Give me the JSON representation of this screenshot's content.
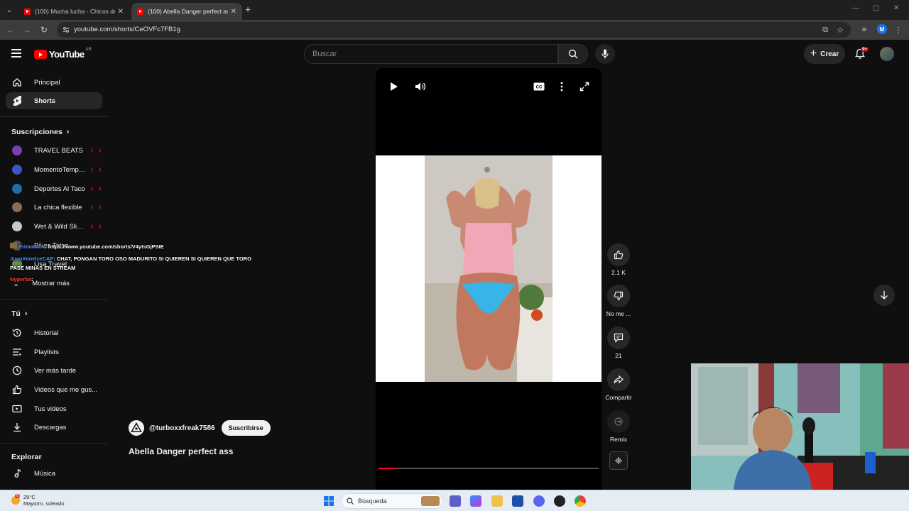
{
  "browser": {
    "tabs": [
      {
        "title": "(100) Mucha lucha - Chicos de",
        "active": false
      },
      {
        "title": "(100) Abella Danger perfect ass",
        "active": true
      }
    ],
    "url": "youtube.com/shorts/CeOVFc7FB1g",
    "profile_initial": "M"
  },
  "yt_header": {
    "logo_text": "YouTube",
    "country": "AR",
    "search_placeholder": "Buscar",
    "create_label": "Crear",
    "notification_badge": "9+"
  },
  "sidebar": {
    "main": [
      {
        "label": "Principal",
        "icon": "home-icon"
      },
      {
        "label": "Shorts",
        "icon": "shorts-icon",
        "active": true
      }
    ],
    "subs_header": "Suscripciones",
    "subscriptions": [
      {
        "name": "TRAVEL BEATS",
        "color": "#7a3fb0"
      },
      {
        "name": "MomentoTempu...",
        "color": "#3a55c7"
      },
      {
        "name": "Deportes Al Taco",
        "color": "#1f6fa8"
      },
      {
        "name": "La chica flexible",
        "color": "#8a6a5a"
      },
      {
        "name": "Wet & Wild Slides",
        "color": "#c8c8c8"
      },
      {
        "name": "Bikes Tatoo",
        "color": "#555555"
      },
      {
        "name": "Lisa Travel",
        "color": "#6a8a4a"
      }
    ],
    "show_more": "Mostrar más",
    "you_header": "Tú",
    "you_items": [
      {
        "label": "Historial",
        "icon": "history-icon"
      },
      {
        "label": "Playlists",
        "icon": "playlist-icon"
      },
      {
        "label": "Ver más tarde",
        "icon": "clock-icon"
      },
      {
        "label": "Videos que me gus...",
        "icon": "thumbs-up-icon"
      },
      {
        "label": "Tus videos",
        "icon": "video-icon"
      },
      {
        "label": "Descargas",
        "icon": "download-icon"
      }
    ],
    "explore_header": "Explorar",
    "explore_items": [
      {
        "label": "Música",
        "icon": "music-icon"
      }
    ]
  },
  "chat_overlay": [
    {
      "user": "PrimaIsOk",
      "text": ": https://www.youtube.com/shorts/V4ytsGjPSIE"
    },
    {
      "user": "JuanXenelzeCAP",
      "text": ": CHAT, PONGAN TORO OSO MADURITO SI QUIEREN SI QUIEREN QUE TORO PASE MINAS EN STREAM"
    },
    {
      "user": "Nyperba",
      "text": ": "
    }
  ],
  "short": {
    "channel": "@turboxxfreak7586",
    "subscribe_label": "Suscribirse",
    "title": "Abella Danger perfect ass",
    "progress": 0.08
  },
  "actions": {
    "likes": "2.1 K",
    "dislike_label": "No me ...",
    "comments": "21",
    "share_label": "Compartir",
    "remix_label": "Remix"
  },
  "taskbar": {
    "temperature": "29°C",
    "weather": "Mayorm. soleado",
    "weather_badge": "6",
    "search_label": "Búsqueda"
  }
}
